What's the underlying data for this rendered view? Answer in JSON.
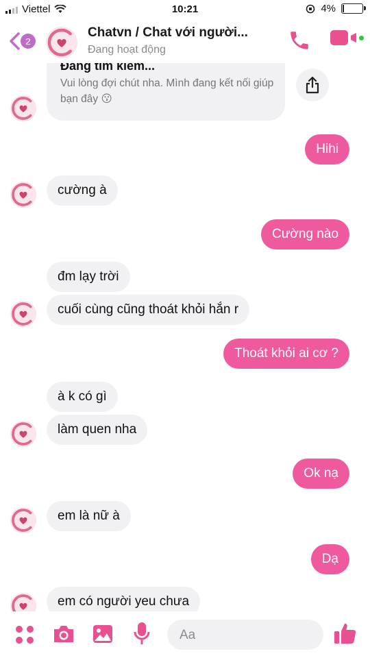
{
  "status_bar": {
    "carrier": "Viettel",
    "time": "10:21",
    "battery": "4%"
  },
  "header": {
    "back_count": "2",
    "title": "Chatvn / Chat với người...",
    "subtitle": "Đang hoạt động"
  },
  "card": {
    "title": "Đang tìm kiếm...",
    "body": "Vui lòng đợi chút nha. Mình đang kết nối giúp bạn đây 😗"
  },
  "messages": [
    {
      "from": "me",
      "text": "Hihi"
    },
    {
      "from": "them",
      "text": "cường à"
    },
    {
      "from": "me",
      "text": "Cường nào"
    },
    {
      "from": "them",
      "text": "đm lạy trời"
    },
    {
      "from": "them",
      "text": "cuối cùng cũng thoát khỏi hắn r"
    },
    {
      "from": "me",
      "text": "Thoát khỏi ai cơ ?"
    },
    {
      "from": "them",
      "text": "à k có gì"
    },
    {
      "from": "them",
      "text": "làm quen nha"
    },
    {
      "from": "me",
      "text": "Ok nạ"
    },
    {
      "from": "them",
      "text": "em là nữ à"
    },
    {
      "from": "me",
      "text": "Dạ"
    },
    {
      "from": "them",
      "text": "em có người yeu chưa"
    }
  ],
  "composer": {
    "placeholder": "Aa"
  },
  "colors": {
    "accent": "#ef5a9f",
    "icon": "#e8508f",
    "incoming_bg": "#f1f1f3"
  }
}
